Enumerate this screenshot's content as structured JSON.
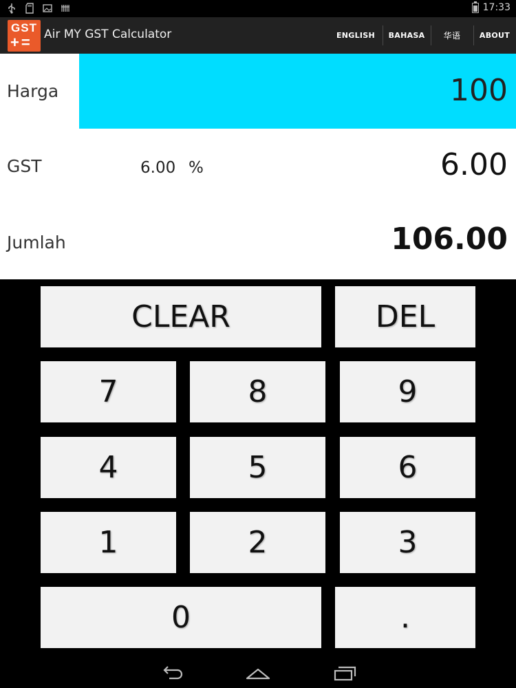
{
  "status_bar": {
    "icons": [
      "usb-icon",
      "sd-card-icon",
      "image-icon",
      "barcode-icon"
    ],
    "time": "17:33"
  },
  "action_bar": {
    "logo_top": "GST",
    "logo_bottom": "+=",
    "title": "Air MY GST Calculator",
    "menu": {
      "english": "ENGLISH",
      "bahasa": "BAHASA",
      "chinese": "华语",
      "about": "ABOUT"
    }
  },
  "display": {
    "harga_label": "Harga",
    "harga_value": "100",
    "gst_label": "GST",
    "gst_rate": "6.00",
    "gst_percent_sign": "%",
    "gst_value": "6.00",
    "jumlah_label": "Jumlah",
    "jumlah_value": "106.00"
  },
  "keypad": {
    "clear": "CLEAR",
    "del": "DEL",
    "k7": "7",
    "k8": "8",
    "k9": "9",
    "k4": "4",
    "k5": "5",
    "k6": "6",
    "k1": "1",
    "k2": "2",
    "k3": "3",
    "k0": "0",
    "dot": "."
  },
  "colors": {
    "input_highlight": "#00ddff",
    "logo": "#ea5a2a",
    "action_bar": "#222222",
    "key_bg": "#f2f2f2"
  }
}
